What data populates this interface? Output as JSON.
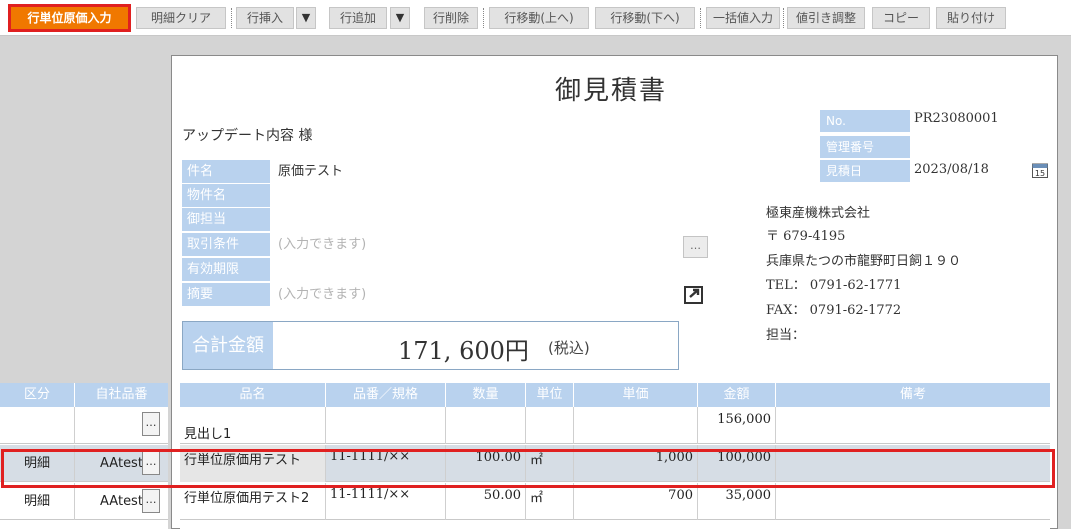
{
  "toolbar": {
    "buttons": [
      {
        "label": "行単位原価入力"
      },
      {
        "label": "明細クリア"
      },
      {
        "label": "行挿入"
      },
      {
        "label": "行追加"
      },
      {
        "label": "行削除"
      },
      {
        "label": "行移動(上へ)"
      },
      {
        "label": "行移動(下へ)"
      },
      {
        "label": "一括値入力"
      },
      {
        "label": "値引き調整"
      },
      {
        "label": "コピー"
      },
      {
        "label": "貼り付け"
      }
    ],
    "dropdown_glyph": "▼"
  },
  "document": {
    "title": "御見積書",
    "customer": "アップデート内容 様",
    "fields": [
      {
        "label": "件名",
        "value": "原価テスト",
        "placeholder": false
      },
      {
        "label": "物件名",
        "value": "",
        "placeholder": false
      },
      {
        "label": "御担当",
        "value": "",
        "placeholder": false
      },
      {
        "label": "取引条件",
        "value": "(入力できます)",
        "placeholder": true
      },
      {
        "label": "有効期限",
        "value": "",
        "placeholder": false
      },
      {
        "label": "摘要",
        "value": "(入力できます)",
        "placeholder": true
      }
    ],
    "more_button": "…",
    "total": {
      "label": "合計金額",
      "amount": "171, 600円",
      "tax": "(税込)"
    },
    "info": [
      {
        "label": "No.",
        "value": "PR23080001"
      },
      {
        "label": "管理番号",
        "value": ""
      },
      {
        "label": "見積日",
        "value": "2023/08/18"
      }
    ],
    "calendar_day": "15",
    "company": {
      "name": "極東産機株式会社",
      "postal": "〒 679-4195",
      "address": "兵庫県たつの市龍野町日飼１９０",
      "tel": "TEL： 0791-62-1771",
      "fax": "FAX： 0791-62-1772",
      "staff": "担当："
    }
  },
  "grid": {
    "left_headers": [
      "区分",
      "自社品番"
    ],
    "headers": [
      "品名",
      "品番／規格",
      "数量",
      "単位",
      "単価",
      "金額",
      "備考"
    ],
    "lookup_glyph": "…",
    "rows": [
      {
        "kubun": "",
        "code": "",
        "name": "見出し1",
        "spec": "",
        "qty": "",
        "unit": "",
        "price": "",
        "amount": "156,000",
        "note": ""
      },
      {
        "kubun": "明細",
        "code": "AAtest",
        "name": "行単位原価用テスト",
        "spec": "11-1111/××",
        "qty": "100.00",
        "unit": "㎡",
        "price": "1,000",
        "amount": "100,000",
        "note": ""
      },
      {
        "kubun": "明細",
        "code": "AAtest",
        "name": "行単位原価用テスト2",
        "spec": "11-1111/××",
        "qty": "50.00",
        "unit": "㎡",
        "price": "700",
        "amount": "35,000",
        "note": ""
      }
    ]
  },
  "colors": {
    "accent": "#f07800",
    "highlight": "#e02020",
    "label_bg": "#b9d2ee",
    "selected_row": "#d6dde5"
  }
}
